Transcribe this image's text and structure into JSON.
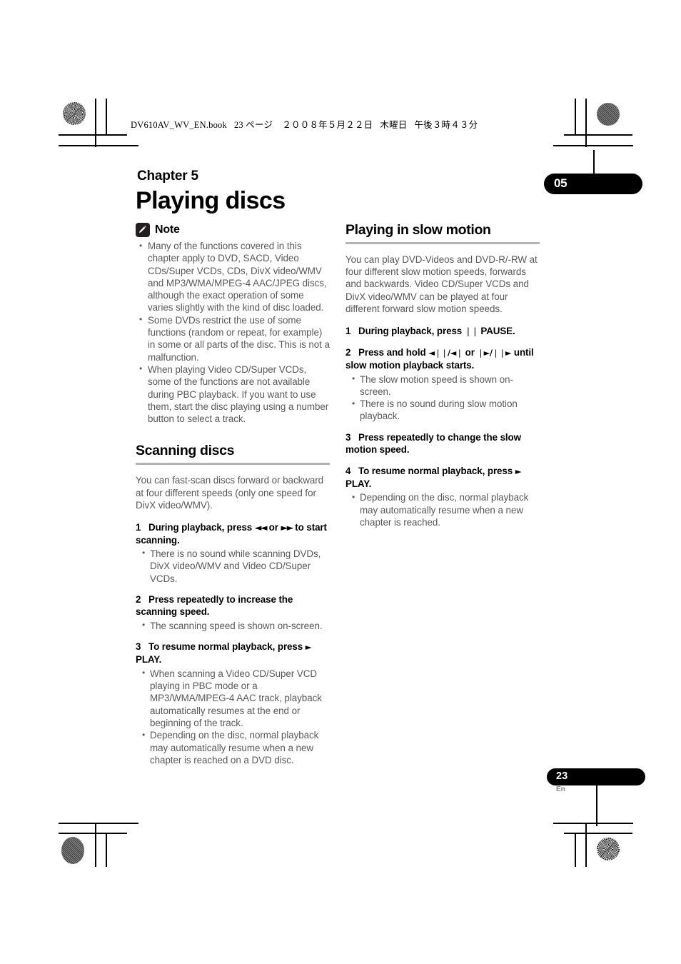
{
  "print_header": {
    "filename": "DV610AV_WV_EN.book",
    "page_marker": "23 ページ",
    "date": "２００８年５月２２日",
    "weekday": "木曜日",
    "time": "午後３時４３分"
  },
  "chapter": {
    "label": "Chapter 5",
    "title": "Playing discs",
    "tab_number": "05"
  },
  "footer": {
    "page_number": "23",
    "language": "En"
  },
  "note": {
    "icon": "pencil-note-icon",
    "heading": "Note",
    "bullets": [
      "Many of the functions covered in this chapter apply to DVD, SACD, Video CDs/Super VCDs, CDs, DivX video/WMV and MP3/WMA/MPEG-4 AAC/JPEG discs, although the exact operation of some varies slightly with the kind of disc loaded.",
      "Some DVDs restrict the use of some functions (random or repeat, for example) in some or all parts of the disc. This is not a malfunction.",
      "When playing Video CD/Super VCDs, some of the functions are not available during PBC playback. If you want to use them, start the disc playing using a number button to select a track."
    ]
  },
  "scanning_discs": {
    "heading": "Scanning discs",
    "intro": "You can fast-scan discs forward or backward at four different speeds (only one speed for DivX video/WMV).",
    "steps": [
      {
        "num": "1",
        "text_before": "During playback, press ",
        "glyph1": "◄◄",
        "text_mid": " or ",
        "glyph2": "►►",
        "text_after": " to start scanning.",
        "bullets": [
          "There is no sound while scanning DVDs, DivX video/WMV and Video CD/Super VCDs."
        ]
      },
      {
        "num": "2",
        "text_before": "Press repeatedly to increase the scanning speed.",
        "bullets": [
          "The scanning speed is shown on-screen."
        ]
      },
      {
        "num": "3",
        "text_before": "To resume normal playback, press ",
        "glyph1": "►",
        "text_after": " PLAY.",
        "bullets": [
          "When scanning a Video CD/Super VCD playing in PBC mode or a MP3/WMA/MPEG-4 AAC track, playback automatically resumes at the end or beginning of the track.",
          "Depending on the disc, normal playback may automatically resume when a new chapter is reached on a DVD disc."
        ]
      }
    ]
  },
  "slow_motion": {
    "heading": "Playing in slow motion",
    "intro": "You can play DVD-Videos and DVD-R/-RW at four different slow motion speeds, forwards and backwards. Video CD/Super VCDs and DivX video/WMV can be played at four different forward slow motion speeds.",
    "steps": [
      {
        "num": "1",
        "text_before": "During playback, press ",
        "glyph1": "❘❘",
        "text_after": " PAUSE.",
        "bullets": []
      },
      {
        "num": "2",
        "text_before": "Press and hold ",
        "glyph1": "◄❘❘/◄❘",
        "text_mid": " or ",
        "glyph2": "❘►/❘❘►",
        "text_after": " until slow motion playback starts.",
        "bullets": [
          "The slow motion speed is shown on-screen.",
          "There is no sound during slow motion playback."
        ]
      },
      {
        "num": "3",
        "text_before": "Press repeatedly to change the slow motion speed.",
        "bullets": []
      },
      {
        "num": "4",
        "text_before": "To resume normal playback, press ",
        "glyph1": "►",
        "text_after": " PLAY.",
        "bullets": [
          "Depending on the disc, normal playback may automatically resume when a new chapter is reached."
        ]
      }
    ]
  },
  "colors": {
    "body_text": "#59595b",
    "rule": "#b3b3b3",
    "tab_background": "#000000"
  }
}
